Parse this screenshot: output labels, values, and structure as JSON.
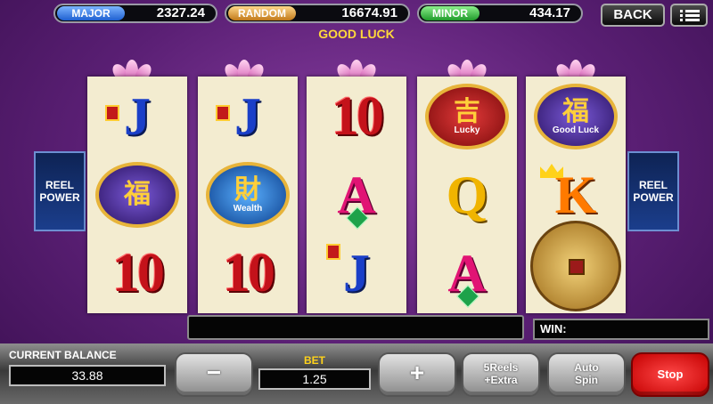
{
  "jackpots": {
    "major": {
      "label": "MAJOR",
      "value": "2327.24"
    },
    "random": {
      "label": "RANDOM",
      "value": "16674.91"
    },
    "minor": {
      "label": "MINOR",
      "value": "434.17"
    }
  },
  "nav": {
    "back_label": "BACK",
    "menu_icon": "menu-icon"
  },
  "banner": {
    "text": "GOOD LUCK"
  },
  "side_badge": {
    "line1": "REEL",
    "line2": "POWER"
  },
  "reels": [
    [
      "J",
      "red-envelope-coin",
      "10"
    ],
    [
      "J",
      "wealth-coin",
      "10"
    ],
    [
      "10",
      "A",
      "J"
    ],
    [
      "lucky-coin",
      "Q",
      "A"
    ],
    [
      "good-luck-coin",
      "K",
      "gold-coin"
    ]
  ],
  "coin_captions": {
    "wealth": "Wealth",
    "lucky": "Lucky",
    "good_luck": "Good Luck"
  },
  "coin_glyphs": {
    "wealth": "財",
    "lucky": "吉",
    "good_luck": "福",
    "envelope": "福"
  },
  "win": {
    "label": "WIN:",
    "value": ""
  },
  "balance": {
    "label": "CURRENT BALANCE",
    "value": "33.88"
  },
  "bet": {
    "label": "BET",
    "value": "1.25"
  },
  "controls": {
    "minus": "−",
    "plus": "+",
    "reels_line1": "5Reels",
    "reels_line2": "+Extra",
    "autospin_line1": "Auto",
    "autospin_line2": "Spin",
    "stop": "Stop"
  },
  "colors": {
    "background": "#5a1f74",
    "accent_gold": "#ffd93a",
    "stop_red": "#e00000"
  }
}
